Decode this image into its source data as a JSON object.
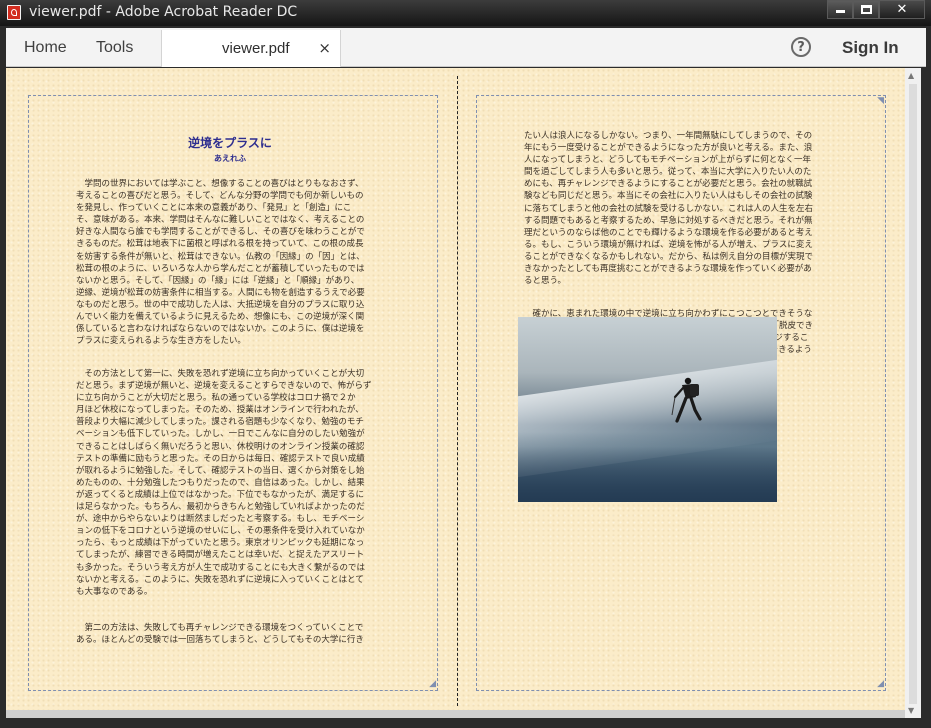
{
  "window": {
    "title": "viewer.pdf - Adobe Acrobat Reader DC"
  },
  "toolbar": {
    "home_label": "Home",
    "tools_label": "Tools",
    "tab_label": "viewer.pdf",
    "tab_close": "×",
    "help_glyph": "?",
    "sign_in_label": "Sign In"
  },
  "icons": {
    "app": "acrobat-icon",
    "minimize": "minimize-icon",
    "maximize": "maximize-icon",
    "close": "close-icon",
    "help": "help-icon"
  },
  "document": {
    "title": "逆境をプラスに",
    "author": "あえれふ",
    "left_paragraph_1": "　学問の世界においては学ぶこと、想像することの喜びはとりもなおさず、\n考えることの喜びだと思う。そして、どんな分野の学問でも何か新しいもの\nを発見し、作っていくことに本来の意義があり、「発見」と「創造」にこ\nそ、意味がある。本来、学問はそんなに難しいことではなく、考えることの\n好きな人間なら誰でも学問することができるし、その喜びを味わうことがで\nきるものだ。松茸は地表下に菌根と呼ばれる根を持っていて、この根の成長\nを妨害する条件が無いと、松茸はできない。仏教の「因縁」の「因」とは、\n松茸の根のように、いろいろな人から学んだことが蓄積していったものでは\nないかと思う。そして、「因縁」の「縁」には「逆縁」と「順縁」があり、\n逆縁、逆境が松茸の妨害条件に相当する。人間にも物を創造するうえで必要\nなものだと思う。世の中で成功した人は、大抵逆境を自分のプラスに取り込\nんでいく能力を備えているように見えるため、想像にも、この逆境が深く関\n係していると言わなければならないのではないか。このように、僕は逆境を\nプラスに変えられるような生き方をしたい。",
    "left_paragraph_2": "　その方法として第一に、失敗を恐れず逆境に立ち向かっていくことが大切\nだと思う。まず逆境が無いと、逆境を変えることすらできないので、怖がらず\nに立ち向かうことが大切だと思う。私の通っている学校はコロナ禍で２か\n月ほど休校になってしまった。そのため、授業はオンラインで行われたが、\n普段より大幅に減少してしまった。課される宿題も少なくなり、勉強のモチ\nベーションも低下していった。しかし、一日でこんなに自分のしたい勉強が\nできることはしばらく無いだろうと思い、休校明けのオンライン授業の確認\nテストの準備に励もうと思った。その日からは毎日、確認テストで良い成績\nが取れるように勉強した。そして、確認テストの当日、選くから対策をし始\nめたものの、十分勉強したつもりだったので、自信はあった。しかし、結果\nが返ってくると成績は上位ではなかった。下位でもなかったが、満足するに\nは足らなかった。もちろん、最初からきちんと勉強していればよかったのだ\nが、途中からやらないよりは断然ましだったと考察する。もし、モチベーシ\nョンの低下をコロナという逆境のせいにし、その悪条件を受け入れていなか\nったら、もっと成績は下がっていたと思う。東京オリンピックも延期になっ\nてしまったが、練習できる時間が増えたことは幸いだ、と捉えたアスリート\nも多かった。そういう考え方が人生で成功することにも大きく繋がるのでは\nないかと考える。このように、失敗を恐れずに逆境に入っていくことはとて\nも大事なのである。",
    "left_paragraph_3": "　第二の方法は、失敗しても再チャレンジできる環境をつくっていくことで\nある。ほとんどの受験では一回落ちてしまうと、どうしてもその大学に行き",
    "right_paragraph_1": "たい人は浪人になるしかない。つまり、一年間無駄にしてしまうので、その\n年にもう一度受けることができるようになった方が良いと考える。また、浪\n人になってしまうと、どうしてもモチベーションが上がらずに何となく一年\n間を過ごしてしまう人も多いと思う。従って、本当に大学に入りたい人のた\nめにも、再チャレンジできるようにすることが必要だと思う。会社の就職試\n験なども同じだと思う。本当にその会社に入りたい人はもしその会社の試験\nに落ちてしまうと他の会社の試験を受けるしかない。これは人の人生を左右\nする問題でもあると考察するため、早急に対処するべきだと思う。それが無\n理だというのならば他のことでも輝けるような環境を作る必要があると考え\nる。もし、こういう環境が無ければ、逆境を怖がる人が増え、プラスに変え\nることができなくなるかもしれない。だから、私は例え自分の目標が実現で\nきなかったとしても再度挑むことができるような環境を作っていく必要があ\nると思う。",
    "right_paragraph_2": "　確かに、恵まれた環境の中で逆境に立ち向かわずにこつこつとできそうな\nことだけをやるという生き方も良い。しかし、最も大切なことは「脱皮でき\nない蛇は滅びる。」という名言もあるように、高い目標にチャレンジするこ\nとだ。そして、逆境に飛び込み、アドバンテージに変えることができるよう\nに鍛えることだ。"
  }
}
